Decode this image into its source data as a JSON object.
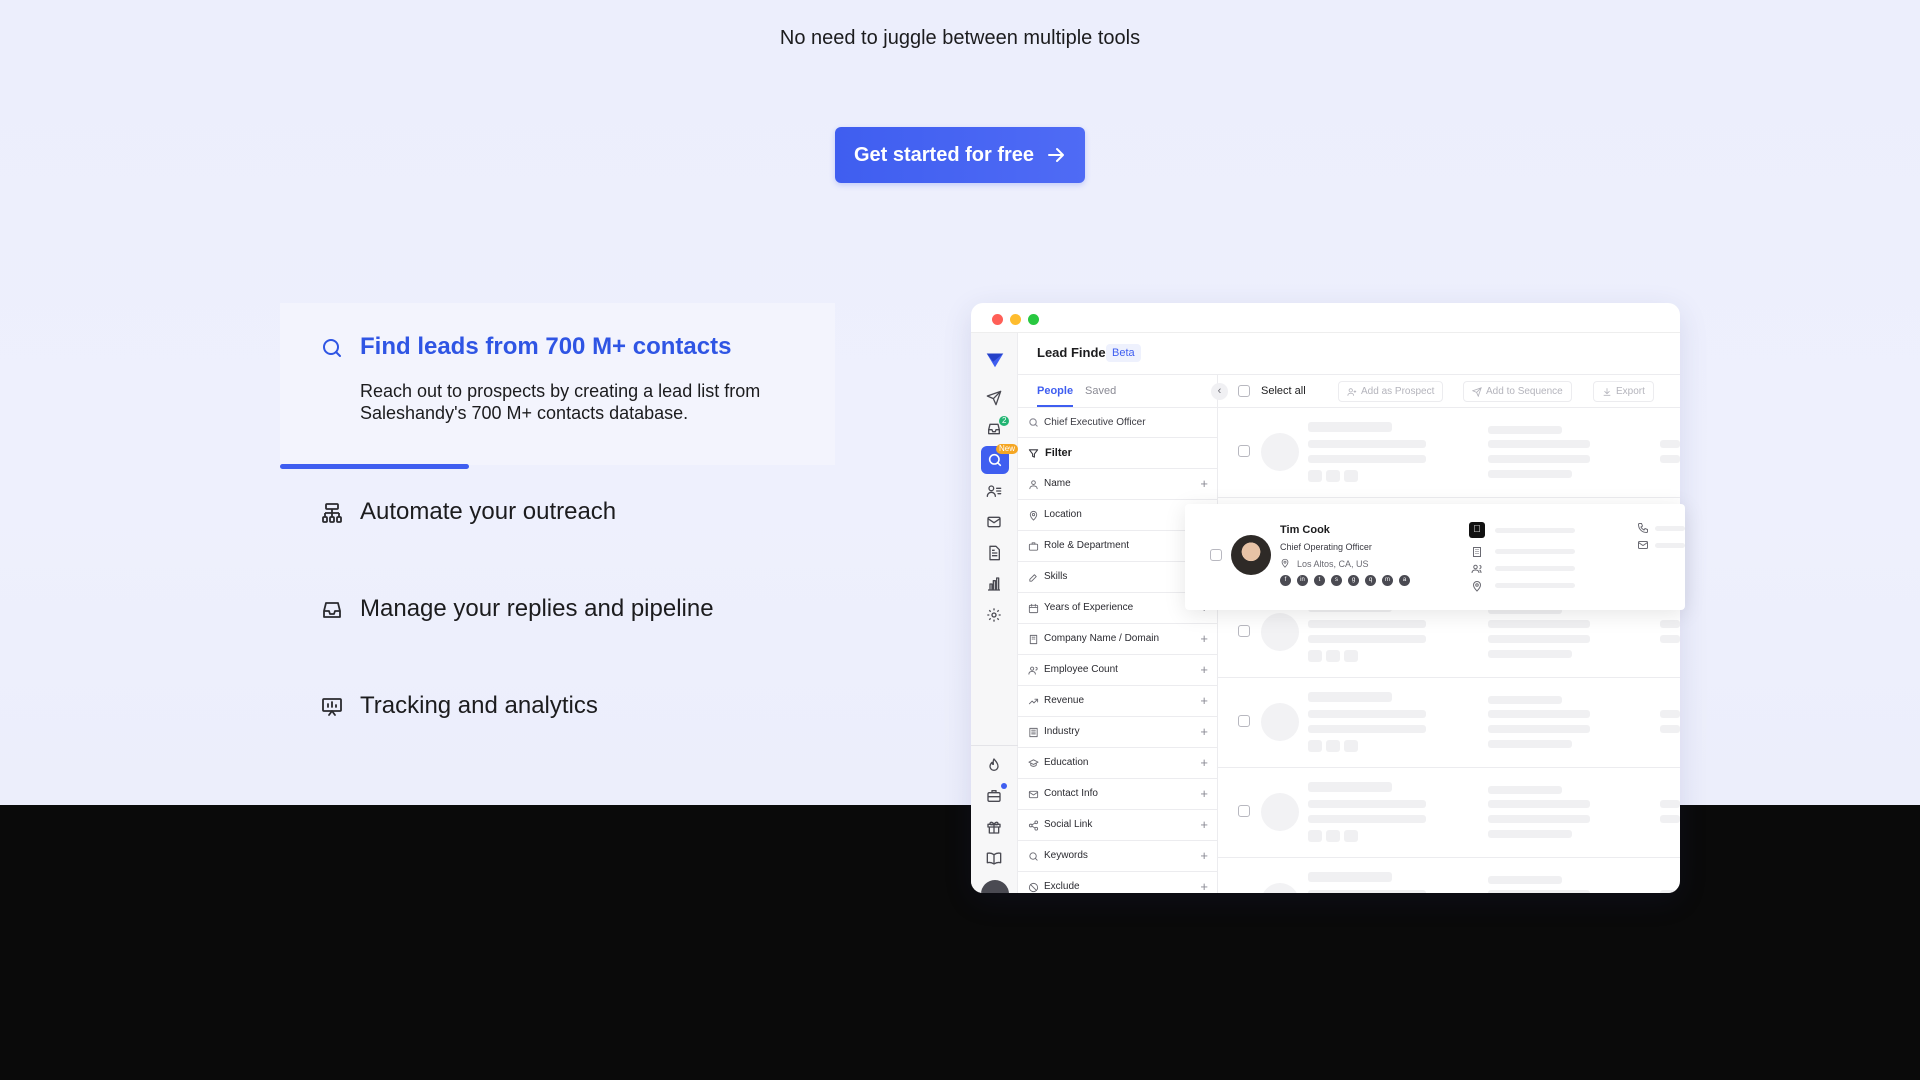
{
  "hero": {
    "tagline": "No need to juggle between multiple tools",
    "cta_label": "Get started for free",
    "accent_color": "#3f5ef0"
  },
  "features": {
    "active": {
      "icon": "search-icon",
      "title": "Find leads from 700 M+ contacts",
      "description": "Reach out to prospects by creating a lead list from Saleshandy's 700 M+ contacts database.",
      "progress": 0.34
    },
    "items": [
      {
        "icon": "sitemap-icon",
        "title": "Automate your outreach"
      },
      {
        "icon": "inbox-icon",
        "title": "Manage your replies and pipeline"
      },
      {
        "icon": "presentation-chart-icon",
        "title": "Tracking and analytics"
      }
    ]
  },
  "app": {
    "title": "Lead Finder",
    "badge": "Beta",
    "sidebar": {
      "inbox_badge": "2",
      "search_badge": "New",
      "icons": [
        "logo-icon",
        "send-icon",
        "inbox-icon",
        "search-icon",
        "prospects-icon",
        "mail-icon",
        "templates-icon",
        "analytics-icon",
        "settings-icon",
        "flame-icon",
        "briefcase-icon",
        "gift-icon",
        "book-icon",
        "avatar"
      ]
    },
    "tabs": {
      "people": "People",
      "saved": "Saved"
    },
    "search_value": "Chief Executive Officer",
    "filter_label": "Filter",
    "filters": [
      "Name",
      "Location",
      "Role & Department",
      "Skills",
      "Years of Experience",
      "Company Name / Domain",
      "Employee Count",
      "Revenue",
      "Industry",
      "Education",
      "Contact Info",
      "Social Link",
      "Keywords",
      "Exclude"
    ],
    "toolbar": {
      "select_all": "Select all",
      "add_prospect": "Add as Prospect",
      "add_sequence": "Add to Sequence",
      "export": "Export"
    },
    "contact": {
      "name": "Tim Cook",
      "role": "Chief Operating Officer",
      "location": "Los Altos, CA, US"
    }
  }
}
